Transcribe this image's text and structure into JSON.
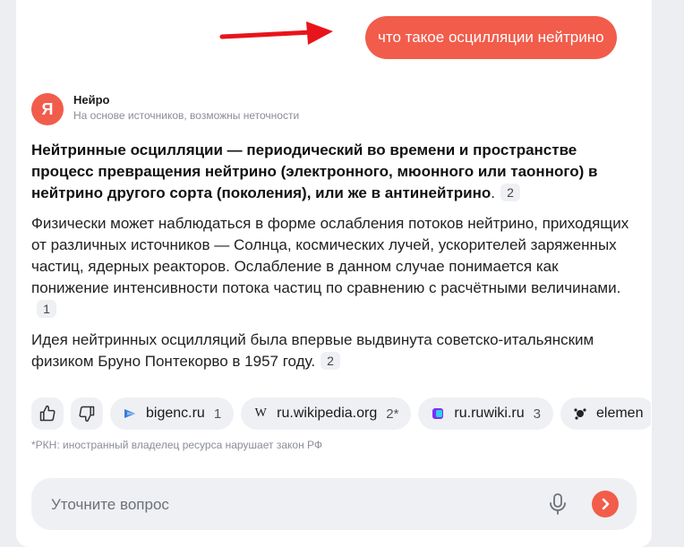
{
  "query": {
    "text": "что такое осцилляции нейтрино"
  },
  "assistant": {
    "name": "Нейро",
    "subtitle": "На основе источников, возможны неточности",
    "avatar_letter": "Я",
    "accent_color": "#f25c4b"
  },
  "answer": {
    "p1_bold": "Нейтринные осцилляции — периодический во времени и пространстве процесс превращения нейтрино (электронного, мюонного или таонного) в нейтрино другого сорта (поколения), или же в антинейтрино",
    "p1_end": ".",
    "p1_ref": "2",
    "p2_text": "Физически может наблюдаться в форме ослабления потоков нейтрино, приходящих от различных источников — Солнца, космических лучей, ускорителей заряженных частиц, ядерных реакторов. Ослабление в данном случае понимается как понижение интенсивности потока частиц по сравнению с расчётными величинами.",
    "p2_ref": "1",
    "p3_text": "Идея нейтринных осцилляций была впервые выдвинута советско-итальянским физиком Бруно Понтекорво в 1957 году.",
    "p3_ref": "2"
  },
  "sources": [
    {
      "site": "bigenc.ru",
      "count": "1",
      "icon": "bigenc-icon"
    },
    {
      "site": "ru.wikipedia.org",
      "count": "2*",
      "icon": "wikipedia-icon"
    },
    {
      "site": "ru.ruwiki.ru",
      "count": "3",
      "icon": "ruwiki-icon"
    },
    {
      "site": "elemen",
      "count": "",
      "icon": "elements-icon"
    }
  ],
  "footnote": "*РКН: иностранный владелец ресурса нарушает закон РФ",
  "followup": {
    "placeholder": "Уточните вопрос"
  },
  "icons": {
    "like": "thumbs-up-icon",
    "dislike": "thumbs-down-icon",
    "mic": "microphone-icon",
    "send": "chevron-right-icon"
  }
}
